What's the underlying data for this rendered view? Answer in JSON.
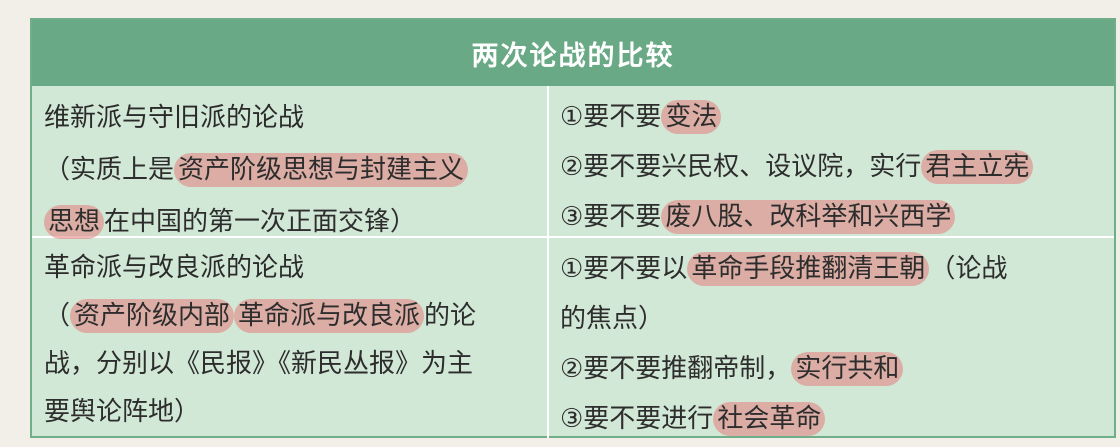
{
  "table": {
    "title": "两次论战的比较",
    "row1": {
      "left_title": "维新派与守旧派的论战",
      "left_desc": {
        "line1_pre": "（实质上是",
        "line1_hl": "资产阶级思想与封建主义",
        "line2_hl": "思想",
        "line2_post": "在中国的第一次正面交锋）"
      },
      "right_items": {
        "item1_pre": "①要不要",
        "item1_hl": "变法",
        "item2_pre": "②要不要兴民权、设议院，实行",
        "item2_hl": "君主立宪",
        "item3_pre": "③要不要",
        "item3_hl": "废八股、改科举和兴西学"
      }
    },
    "row2": {
      "left_title": "革命派与改良派的论战",
      "left_desc": {
        "line1_pre": "（",
        "line1_hl1": "资产阶级内部",
        "line1_hl2": "革命派与改良派",
        "line1_post": "的论",
        "line2": "战，分别以《民报》《新民丛报》为主",
        "line3": "要舆论阵地）"
      },
      "right_items": {
        "item1_pre": "①要不要以",
        "item1_hl": "革命手段推翻清王朝",
        "item1_post": "（论战",
        "item1_cont": "的焦点）",
        "item2_pre": "②要不要推翻帝制，",
        "item2_hl": "实行共和",
        "item3_pre": "③要不要进行",
        "item3_hl": "社会革命"
      }
    }
  }
}
